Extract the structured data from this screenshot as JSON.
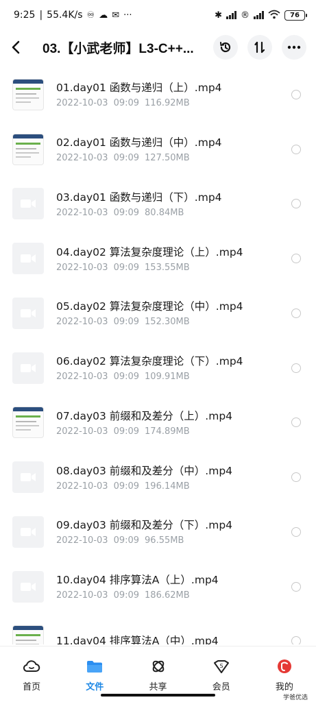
{
  "status_bar": {
    "time": "9:25",
    "speed": "55.4K/s",
    "battery": "76"
  },
  "header": {
    "title": "03.【小武老师】L3-C++..."
  },
  "files": [
    {
      "name": "01.day01 函数与递归（上）.mp4",
      "date": "2022-10-03",
      "time": "09:09",
      "size": "116.92MB",
      "thumb": "screenshot"
    },
    {
      "name": "02.day01 函数与递归（中）.mp4",
      "date": "2022-10-03",
      "time": "09:09",
      "size": "127.50MB",
      "thumb": "screenshot"
    },
    {
      "name": "03.day01 函数与递归（下）.mp4",
      "date": "2022-10-03",
      "time": "09:09",
      "size": "80.84MB",
      "thumb": "video"
    },
    {
      "name": "04.day02 算法复杂度理论（上）.mp4",
      "date": "2022-10-03",
      "time": "09:09",
      "size": "153.55MB",
      "thumb": "video"
    },
    {
      "name": "05.day02 算法复杂度理论（中）.mp4",
      "date": "2022-10-03",
      "time": "09:09",
      "size": "152.30MB",
      "thumb": "video"
    },
    {
      "name": "06.day02 算法复杂度理论（下）.mp4",
      "date": "2022-10-03",
      "time": "09:09",
      "size": "109.91MB",
      "thumb": "video"
    },
    {
      "name": "07.day03 前缀和及差分（上）.mp4",
      "date": "2022-10-03",
      "time": "09:09",
      "size": "174.89MB",
      "thumb": "screenshot"
    },
    {
      "name": "08.day03 前缀和及差分（中）.mp4",
      "date": "2022-10-03",
      "time": "09:09",
      "size": "196.14MB",
      "thumb": "video"
    },
    {
      "name": "09.day03 前缀和及差分（下）.mp4",
      "date": "2022-10-03",
      "time": "09:09",
      "size": "96.55MB",
      "thumb": "video"
    },
    {
      "name": "10.day04 排序算法A（上）.mp4",
      "date": "2022-10-03",
      "time": "09:09",
      "size": "186.62MB",
      "thumb": "video"
    },
    {
      "name": "11.day04 排序算法A（中）.mp4",
      "date": "",
      "time": "",
      "size": "",
      "thumb": "screenshot"
    }
  ],
  "nav": {
    "items": [
      {
        "label": "首页",
        "icon": "cloud-icon"
      },
      {
        "label": "文件",
        "icon": "folder-icon"
      },
      {
        "label": "共享",
        "icon": "share-icon"
      },
      {
        "label": "会员",
        "icon": "vip-icon"
      },
      {
        "label": "我的",
        "icon": "profile-icon"
      }
    ],
    "active": 1
  },
  "watermark": {
    "text_a": "学爸",
    "text_b": "优",
    "text_c": "选",
    "small": "学爸优选"
  },
  "colors": {
    "accent": "#1e88e5",
    "meta": "#9aa0a6"
  }
}
